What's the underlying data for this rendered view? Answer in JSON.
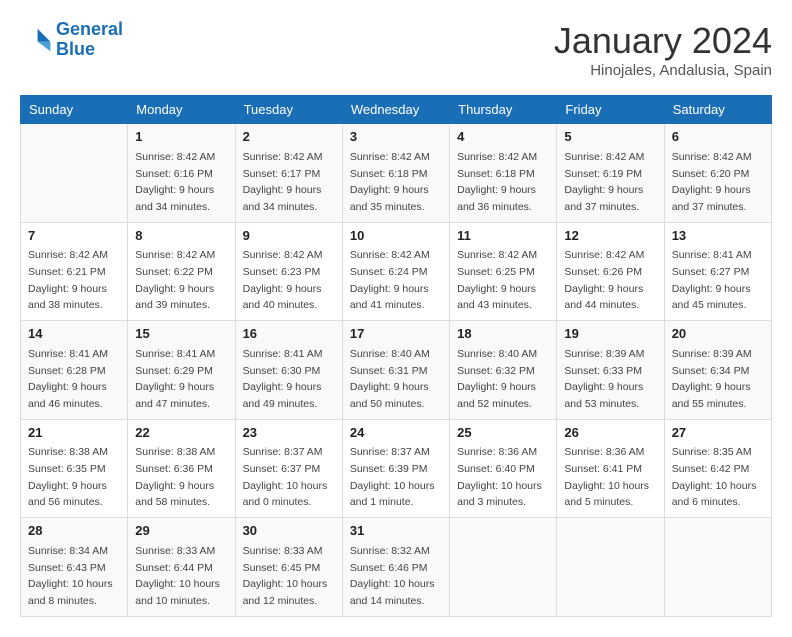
{
  "logo": {
    "line1": "General",
    "line2": "Blue"
  },
  "title": "January 2024",
  "subtitle": "Hinojales, Andalusia, Spain",
  "headers": [
    "Sunday",
    "Monday",
    "Tuesday",
    "Wednesday",
    "Thursday",
    "Friday",
    "Saturday"
  ],
  "weeks": [
    [
      {
        "day": "",
        "sunrise": "",
        "sunset": "",
        "daylight": ""
      },
      {
        "day": "1",
        "sunrise": "Sunrise: 8:42 AM",
        "sunset": "Sunset: 6:16 PM",
        "daylight": "Daylight: 9 hours and 34 minutes."
      },
      {
        "day": "2",
        "sunrise": "Sunrise: 8:42 AM",
        "sunset": "Sunset: 6:17 PM",
        "daylight": "Daylight: 9 hours and 34 minutes."
      },
      {
        "day": "3",
        "sunrise": "Sunrise: 8:42 AM",
        "sunset": "Sunset: 6:18 PM",
        "daylight": "Daylight: 9 hours and 35 minutes."
      },
      {
        "day": "4",
        "sunrise": "Sunrise: 8:42 AM",
        "sunset": "Sunset: 6:18 PM",
        "daylight": "Daylight: 9 hours and 36 minutes."
      },
      {
        "day": "5",
        "sunrise": "Sunrise: 8:42 AM",
        "sunset": "Sunset: 6:19 PM",
        "daylight": "Daylight: 9 hours and 37 minutes."
      },
      {
        "day": "6",
        "sunrise": "Sunrise: 8:42 AM",
        "sunset": "Sunset: 6:20 PM",
        "daylight": "Daylight: 9 hours and 37 minutes."
      }
    ],
    [
      {
        "day": "7",
        "sunrise": "Sunrise: 8:42 AM",
        "sunset": "Sunset: 6:21 PM",
        "daylight": "Daylight: 9 hours and 38 minutes."
      },
      {
        "day": "8",
        "sunrise": "Sunrise: 8:42 AM",
        "sunset": "Sunset: 6:22 PM",
        "daylight": "Daylight: 9 hours and 39 minutes."
      },
      {
        "day": "9",
        "sunrise": "Sunrise: 8:42 AM",
        "sunset": "Sunset: 6:23 PM",
        "daylight": "Daylight: 9 hours and 40 minutes."
      },
      {
        "day": "10",
        "sunrise": "Sunrise: 8:42 AM",
        "sunset": "Sunset: 6:24 PM",
        "daylight": "Daylight: 9 hours and 41 minutes."
      },
      {
        "day": "11",
        "sunrise": "Sunrise: 8:42 AM",
        "sunset": "Sunset: 6:25 PM",
        "daylight": "Daylight: 9 hours and 43 minutes."
      },
      {
        "day": "12",
        "sunrise": "Sunrise: 8:42 AM",
        "sunset": "Sunset: 6:26 PM",
        "daylight": "Daylight: 9 hours and 44 minutes."
      },
      {
        "day": "13",
        "sunrise": "Sunrise: 8:41 AM",
        "sunset": "Sunset: 6:27 PM",
        "daylight": "Daylight: 9 hours and 45 minutes."
      }
    ],
    [
      {
        "day": "14",
        "sunrise": "Sunrise: 8:41 AM",
        "sunset": "Sunset: 6:28 PM",
        "daylight": "Daylight: 9 hours and 46 minutes."
      },
      {
        "day": "15",
        "sunrise": "Sunrise: 8:41 AM",
        "sunset": "Sunset: 6:29 PM",
        "daylight": "Daylight: 9 hours and 47 minutes."
      },
      {
        "day": "16",
        "sunrise": "Sunrise: 8:41 AM",
        "sunset": "Sunset: 6:30 PM",
        "daylight": "Daylight: 9 hours and 49 minutes."
      },
      {
        "day": "17",
        "sunrise": "Sunrise: 8:40 AM",
        "sunset": "Sunset: 6:31 PM",
        "daylight": "Daylight: 9 hours and 50 minutes."
      },
      {
        "day": "18",
        "sunrise": "Sunrise: 8:40 AM",
        "sunset": "Sunset: 6:32 PM",
        "daylight": "Daylight: 9 hours and 52 minutes."
      },
      {
        "day": "19",
        "sunrise": "Sunrise: 8:39 AM",
        "sunset": "Sunset: 6:33 PM",
        "daylight": "Daylight: 9 hours and 53 minutes."
      },
      {
        "day": "20",
        "sunrise": "Sunrise: 8:39 AM",
        "sunset": "Sunset: 6:34 PM",
        "daylight": "Daylight: 9 hours and 55 minutes."
      }
    ],
    [
      {
        "day": "21",
        "sunrise": "Sunrise: 8:38 AM",
        "sunset": "Sunset: 6:35 PM",
        "daylight": "Daylight: 9 hours and 56 minutes."
      },
      {
        "day": "22",
        "sunrise": "Sunrise: 8:38 AM",
        "sunset": "Sunset: 6:36 PM",
        "daylight": "Daylight: 9 hours and 58 minutes."
      },
      {
        "day": "23",
        "sunrise": "Sunrise: 8:37 AM",
        "sunset": "Sunset: 6:37 PM",
        "daylight": "Daylight: 10 hours and 0 minutes."
      },
      {
        "day": "24",
        "sunrise": "Sunrise: 8:37 AM",
        "sunset": "Sunset: 6:39 PM",
        "daylight": "Daylight: 10 hours and 1 minute."
      },
      {
        "day": "25",
        "sunrise": "Sunrise: 8:36 AM",
        "sunset": "Sunset: 6:40 PM",
        "daylight": "Daylight: 10 hours and 3 minutes."
      },
      {
        "day": "26",
        "sunrise": "Sunrise: 8:36 AM",
        "sunset": "Sunset: 6:41 PM",
        "daylight": "Daylight: 10 hours and 5 minutes."
      },
      {
        "day": "27",
        "sunrise": "Sunrise: 8:35 AM",
        "sunset": "Sunset: 6:42 PM",
        "daylight": "Daylight: 10 hours and 6 minutes."
      }
    ],
    [
      {
        "day": "28",
        "sunrise": "Sunrise: 8:34 AM",
        "sunset": "Sunset: 6:43 PM",
        "daylight": "Daylight: 10 hours and 8 minutes."
      },
      {
        "day": "29",
        "sunrise": "Sunrise: 8:33 AM",
        "sunset": "Sunset: 6:44 PM",
        "daylight": "Daylight: 10 hours and 10 minutes."
      },
      {
        "day": "30",
        "sunrise": "Sunrise: 8:33 AM",
        "sunset": "Sunset: 6:45 PM",
        "daylight": "Daylight: 10 hours and 12 minutes."
      },
      {
        "day": "31",
        "sunrise": "Sunrise: 8:32 AM",
        "sunset": "Sunset: 6:46 PM",
        "daylight": "Daylight: 10 hours and 14 minutes."
      },
      {
        "day": "",
        "sunrise": "",
        "sunset": "",
        "daylight": ""
      },
      {
        "day": "",
        "sunrise": "",
        "sunset": "",
        "daylight": ""
      },
      {
        "day": "",
        "sunrise": "",
        "sunset": "",
        "daylight": ""
      }
    ]
  ]
}
